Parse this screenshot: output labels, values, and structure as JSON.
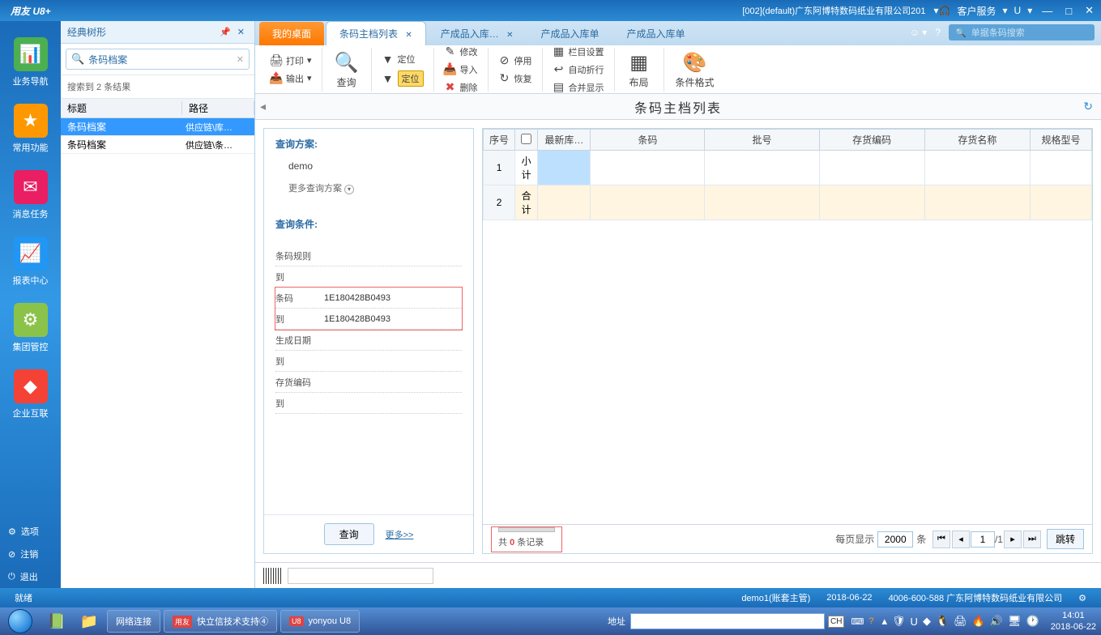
{
  "titlebar": {
    "logo": "用友 U8+",
    "org": "[002](default)广东阿博特数码纸业有限公司201",
    "cs": "客户服务",
    "u": "U"
  },
  "left_rail": {
    "items": [
      {
        "label": "业务导航",
        "color": "#4caf50"
      },
      {
        "label": "常用功能",
        "color": "#ff9800"
      },
      {
        "label": "消息任务",
        "color": "#e91e63"
      },
      {
        "label": "报表中心",
        "color": "#2196f3"
      },
      {
        "label": "集团管控",
        "color": "#8bc34a"
      },
      {
        "label": "企业互联",
        "color": "#f44336"
      }
    ],
    "bottom": {
      "options": "选项",
      "logout": "注销",
      "exit": "退出"
    }
  },
  "tree": {
    "title": "经典树形",
    "search_value": "条码档案",
    "result_info": "搜索到 2 条结果",
    "headers": {
      "title": "标题",
      "path": "路径"
    },
    "rows": [
      {
        "title": "条码档案",
        "path": "供应链\\库…",
        "selected": true
      },
      {
        "title": "条码档案",
        "path": "供应链\\条…",
        "selected": false
      }
    ]
  },
  "tabs": {
    "home": "我的桌面",
    "items": [
      {
        "label": "条码主档列表",
        "active": true
      },
      {
        "label": "产成品入库…",
        "active": false
      },
      {
        "label": "产成品入库单",
        "active": false
      },
      {
        "label": "产成品入库单",
        "active": false
      }
    ],
    "search_placeholder": "单据条码搜索"
  },
  "ribbon": {
    "print": "打印",
    "export": "输出",
    "query": "查询",
    "locate": "定位",
    "modify": "修改",
    "import": "导入",
    "delete": "删除",
    "stop": "停用",
    "restore": "恢复",
    "col_settings": "栏目设置",
    "wrap": "自动折行",
    "merge": "合并显示",
    "layout": "布局",
    "cond_format": "条件格式"
  },
  "content": {
    "title": "条码主档列表"
  },
  "query": {
    "scheme_title": "查询方案:",
    "scheme": "demo",
    "more_schemes": "更多查询方案",
    "conditions_title": "查询条件:",
    "fields": [
      {
        "label": "条码规则",
        "value": ""
      },
      {
        "label": "到",
        "value": ""
      },
      {
        "label": "条码",
        "value": "1E180428B0493",
        "hl": true
      },
      {
        "label": "到",
        "value": "1E180428B0493",
        "hl": true
      },
      {
        "label": "生成日期",
        "value": ""
      },
      {
        "label": "到",
        "value": ""
      },
      {
        "label": "存货编码",
        "value": ""
      },
      {
        "label": "到",
        "value": ""
      }
    ],
    "query_btn": "查询",
    "more_link": "更多>>"
  },
  "table": {
    "headers": {
      "seq": "序号",
      "latest": "最新库…",
      "barcode": "条码",
      "batch": "批号",
      "stock_code": "存货编码",
      "stock_name": "存货名称",
      "spec": "规格型号"
    },
    "rows": [
      {
        "num": "1",
        "type": "小计"
      },
      {
        "num": "2",
        "type": "合计"
      }
    ]
  },
  "pagination": {
    "total_prefix": "共",
    "total_count": "0",
    "total_suffix": "条记录",
    "page_size_label": "每页显示",
    "page_size": "2000",
    "unit": "条",
    "current_page": "1",
    "total_pages": "/1",
    "jump": "跳转"
  },
  "status": {
    "ready": "就绪",
    "user": "demo1(账套主管)",
    "date": "2018-06-22",
    "contact": "4006-600-588 广东阿博特数码纸业有限公司"
  },
  "taskbar": {
    "net": "网络连接",
    "kx": "快立信技术支持④",
    "u8": "yonyou U8",
    "addr_label": "地址",
    "lang": "CH",
    "time": "14:01",
    "date": "2018-06-22"
  }
}
